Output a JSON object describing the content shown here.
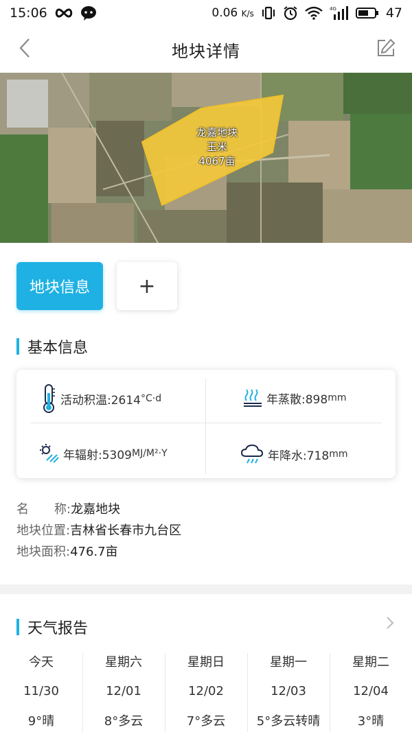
{
  "status_bar": {
    "time": "15:06",
    "network_speed": "0.06",
    "speed_unit": "K/s",
    "battery": "47",
    "icons": [
      "infinity-icon",
      "wechat-icon",
      "vibrate-icon",
      "alarm-icon",
      "wifi-icon",
      "signal-4g-icon",
      "battery-icon"
    ]
  },
  "nav": {
    "title": "地块详情",
    "back_icon": "chevron-left-icon",
    "edit_icon": "edit-icon"
  },
  "map": {
    "plot_name": "龙嘉地块",
    "crop": "玉米",
    "area_label": "4067亩",
    "plot_color": "#f5c93a"
  },
  "tabs": {
    "active_label": "地块信息",
    "add_label": "+"
  },
  "basic_info": {
    "section_title": "基本信息",
    "climate": {
      "temp_label": "活动积温:2614",
      "temp_unit": "°C·d",
      "evap_label": "年蒸散:898",
      "evap_unit": "mm",
      "rad_label": "年辐射:5309",
      "rad_unit": "MJ/M²·Y",
      "precip_label": "年降水:718",
      "precip_unit": "mm"
    },
    "fields": {
      "name_key_a": "名",
      "name_key_b": "称:",
      "name_value": "龙嘉地块",
      "location_key": "地块位置:",
      "location_value": "吉林省长春市九台区",
      "area_key": "地块面积:",
      "area_value": "476.7亩"
    }
  },
  "weather": {
    "section_title": "天气报告",
    "days": [
      {
        "day": "今天",
        "date": "11/30",
        "cond": "9°晴"
      },
      {
        "day": "星期六",
        "date": "12/01",
        "cond": "8°多云"
      },
      {
        "day": "星期日",
        "date": "12/02",
        "cond": "7°多云"
      },
      {
        "day": "星期一",
        "date": "12/03",
        "cond": "5°多云转晴"
      },
      {
        "day": "星期二",
        "date": "12/04",
        "cond": "3°晴"
      }
    ]
  },
  "colors": {
    "accent": "#1fb1e3",
    "plot": "#f5c93a"
  }
}
